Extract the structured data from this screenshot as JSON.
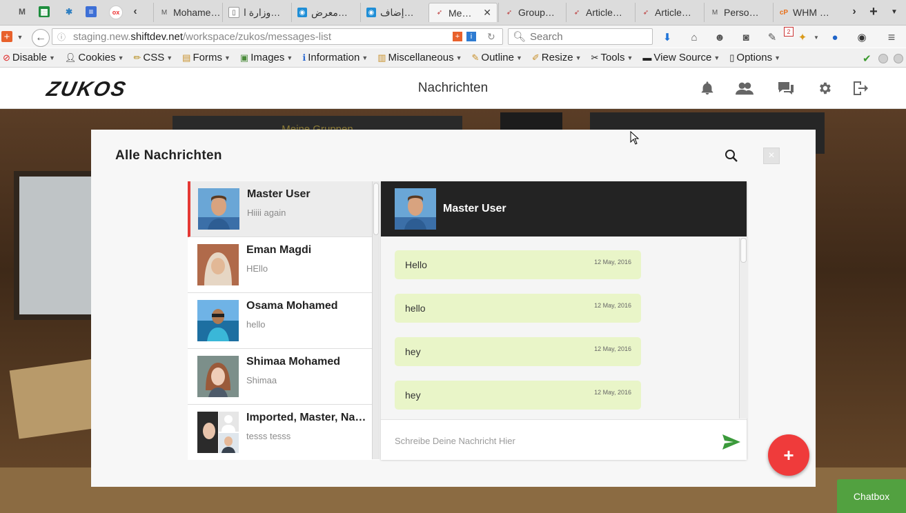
{
  "browser": {
    "tabs": [
      {
        "label": "Mohame…",
        "icon": "gmail-icon"
      },
      {
        "label": "وزارة ا…",
        "icon": "doc-icon"
      },
      {
        "label": "معرض…",
        "icon": "app-icon"
      },
      {
        "label": "إضاف…",
        "icon": "app-icon"
      },
      {
        "label": "Me…",
        "icon": "bird-icon",
        "active": true
      },
      {
        "label": "Group…",
        "icon": "bird-icon"
      },
      {
        "label": "Article…",
        "icon": "bird-icon"
      },
      {
        "label": "Article…",
        "icon": "bird-icon"
      },
      {
        "label": "Perso…",
        "icon": "gmail-icon"
      },
      {
        "label": "WHM …",
        "icon": "cpanel-icon"
      }
    ],
    "close_glyph": "✕",
    "url_prefix": "staging.new.",
    "url_domain": "shiftdev.net",
    "url_path": "/workspace/zukos/messages-list",
    "search_placeholder": "Search",
    "badge_count": "2",
    "devtools": [
      {
        "label": "Disable",
        "icon": "no-icon"
      },
      {
        "label": "Cookies",
        "icon": "user-icon"
      },
      {
        "label": "CSS",
        "icon": "pencil-icon"
      },
      {
        "label": "Forms",
        "icon": "form-icon"
      },
      {
        "label": "Images",
        "icon": "image-icon"
      },
      {
        "label": "Information",
        "icon": "info-icon"
      },
      {
        "label": "Miscellaneous",
        "icon": "misc-icon"
      },
      {
        "label": "Outline",
        "icon": "outline-icon"
      },
      {
        "label": "Resize",
        "icon": "resize-icon"
      },
      {
        "label": "Tools",
        "icon": "tools-icon"
      },
      {
        "label": "View Source",
        "icon": "source-icon"
      },
      {
        "label": "Options",
        "icon": "options-icon"
      }
    ]
  },
  "app": {
    "logo": "ZUKOS",
    "page_title": "Nachrichten",
    "background_board": "Meine Gruppen"
  },
  "modal": {
    "title": "Alle Nachrichten",
    "close_glyph": "×",
    "conversations": [
      {
        "name": "Master User",
        "preview": "Hiiii again",
        "active": true
      },
      {
        "name": "Eman Magdi",
        "preview": "HEllo"
      },
      {
        "name": "Osama Mohamed",
        "preview": "hello"
      },
      {
        "name": "Shimaa Mohamed",
        "preview": "Shimaa"
      },
      {
        "name": "Imported, Master, Na…",
        "preview": "tesss tesss"
      }
    ],
    "chat": {
      "contact_name": "Master User",
      "messages": [
        {
          "text": "Hello",
          "date": "12 May, 2016"
        },
        {
          "text": "hello",
          "date": "12 May, 2016"
        },
        {
          "text": "hey",
          "date": "12 May, 2016"
        },
        {
          "text": "hey",
          "date": "12 May, 2016"
        }
      ],
      "compose_placeholder": "Schreibe Deine Nachricht Hier"
    }
  },
  "fab_label": "+",
  "chatbox_label": "Chatbox",
  "colors": {
    "accent_red": "#ef3b3b",
    "chat_header": "#232323",
    "bubble": "#e9f5c8",
    "chatbox_green": "#52a140",
    "send_green": "#3b9a3b"
  }
}
